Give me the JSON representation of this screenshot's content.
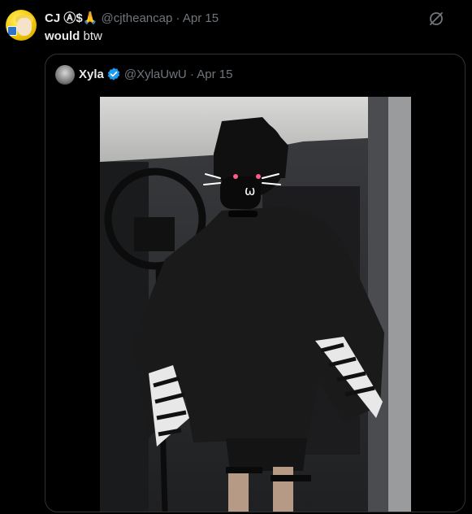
{
  "post": {
    "author_name": "CJ Ⓐ$🙏",
    "handle": "@cjtheancap",
    "separator": "·",
    "date": "Apr 15",
    "text_bold": "would",
    "text_rest": " btw"
  },
  "quote": {
    "author_name": "Xyla",
    "handle": "@XylaUwU",
    "separator": "·",
    "date": "Apr 15"
  },
  "icons": {
    "grok": "grok-icon",
    "verified": "verified-badge-icon"
  },
  "colors": {
    "background": "#000000",
    "text": "#e7e9ea",
    "muted": "#71767b",
    "verified": "#1d9bf0",
    "border": "#2f3336"
  }
}
